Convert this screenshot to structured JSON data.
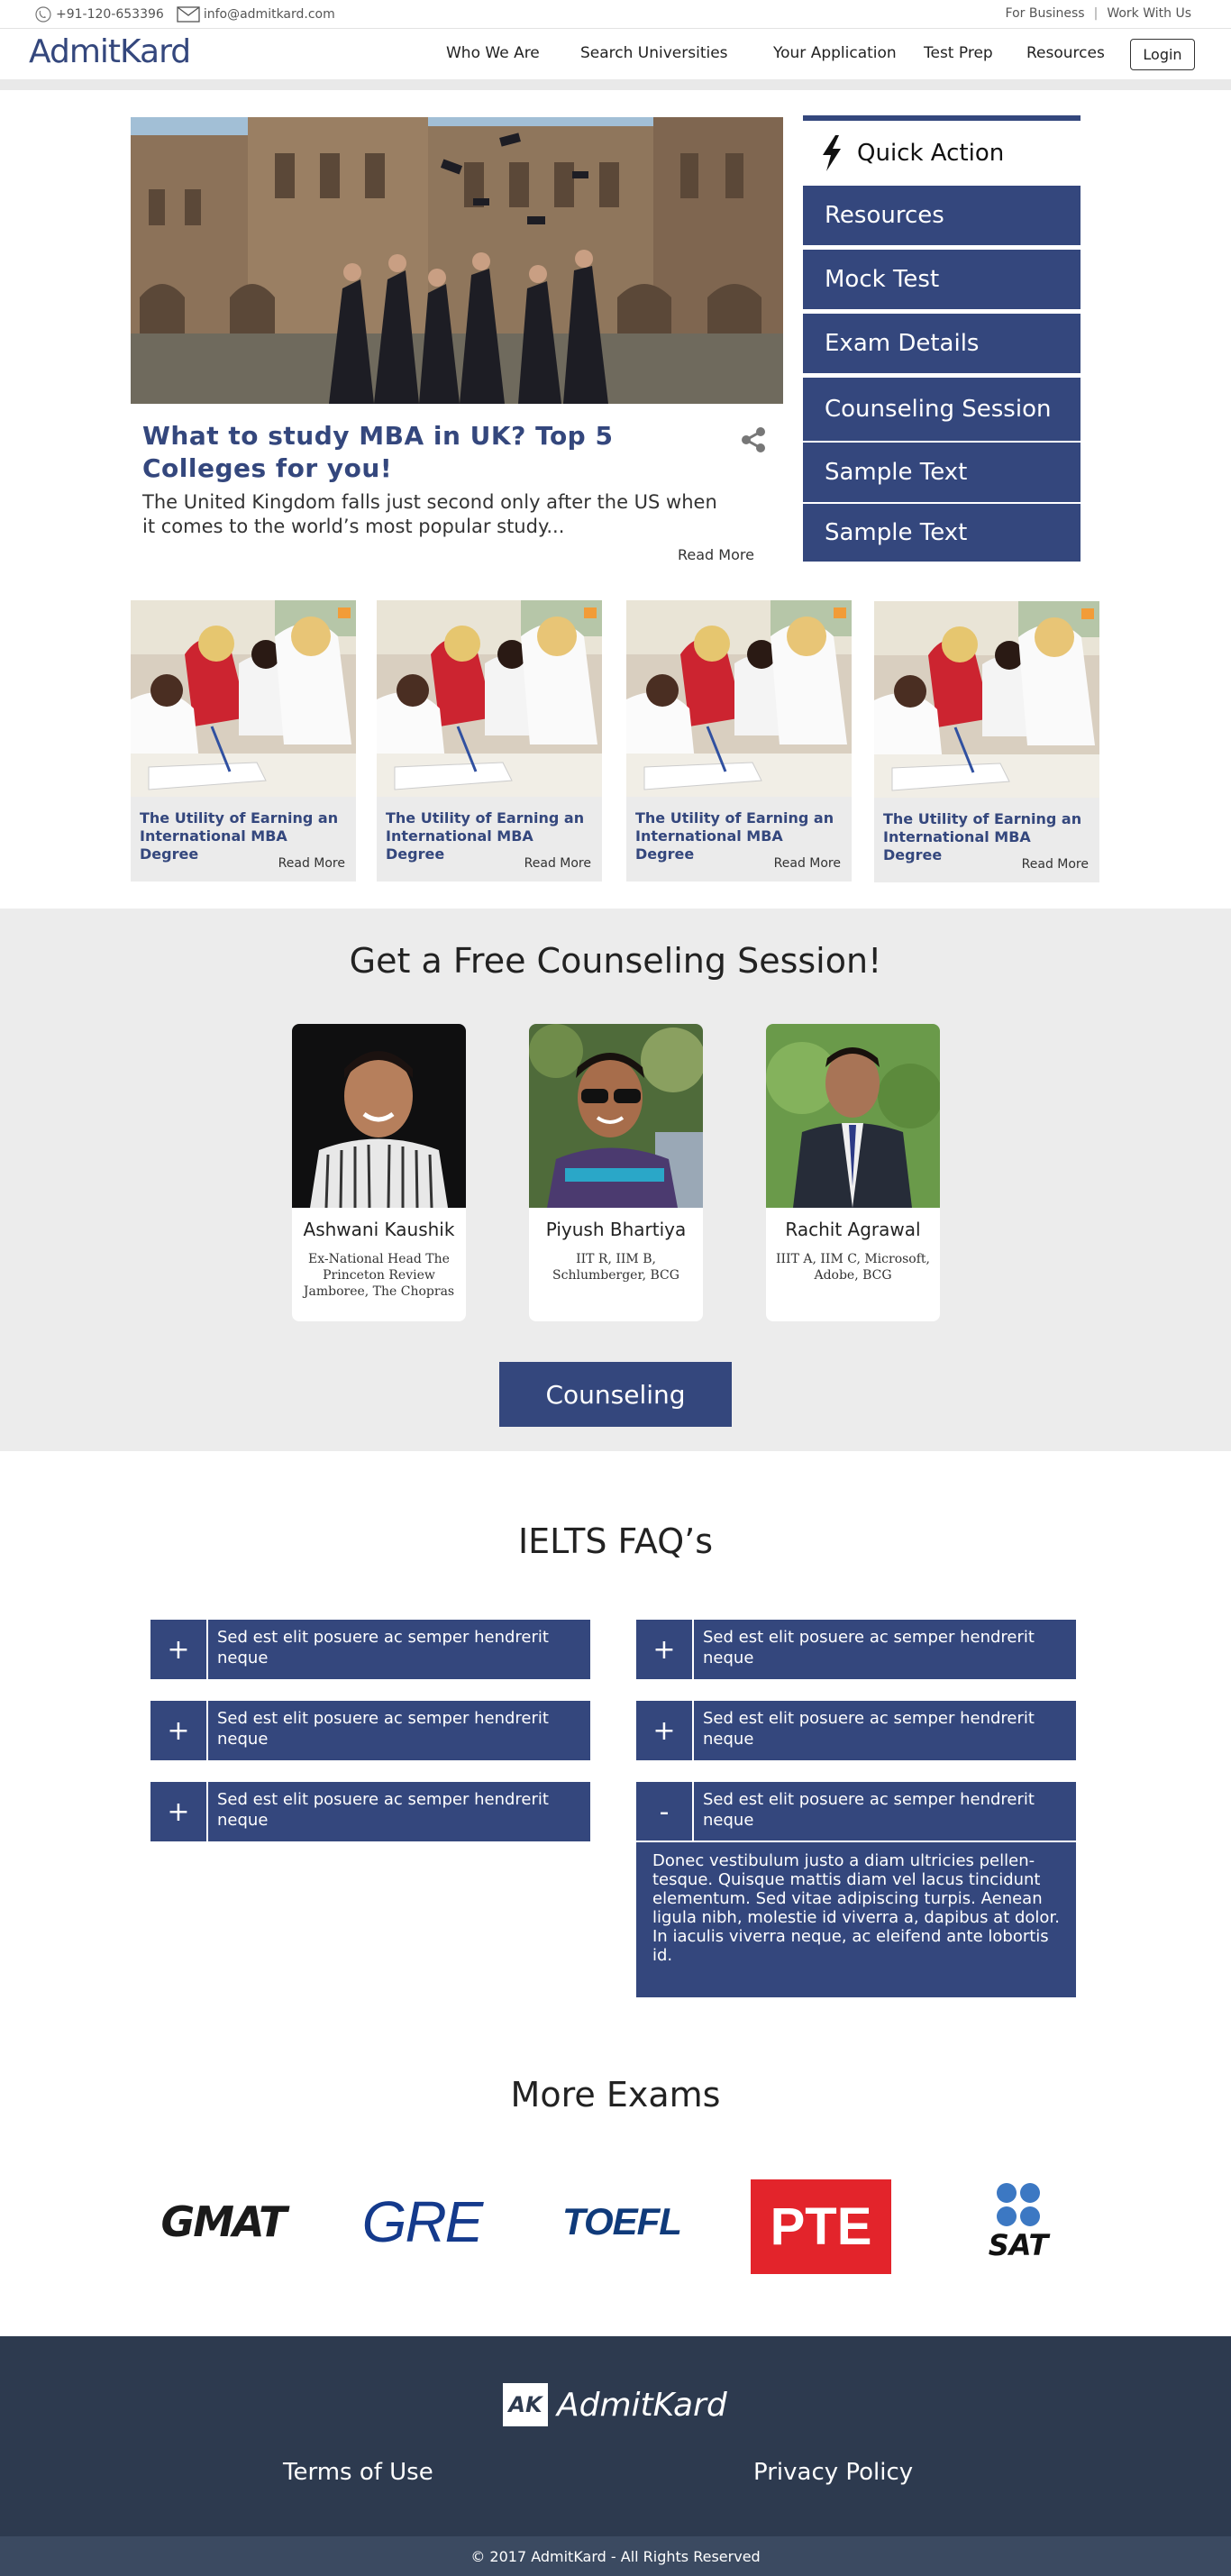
{
  "topbar": {
    "phone": "+91-120-653396",
    "email": "info@admitkard.com",
    "for_business": "For Business",
    "separator": "|",
    "work_with_us": "Work With Us"
  },
  "nav": {
    "logo": "AdmitKard",
    "links": [
      "Who We Are",
      "Search Universities",
      "Your Application",
      "Test Prep",
      "Resources"
    ],
    "login": "Login"
  },
  "hero": {
    "title": "What to study MBA in UK? Top 5 Colleges for you!",
    "description": "The United Kingdom falls just second only after the US when it comes to the world’s  most popular study...",
    "read_more": "Read More"
  },
  "quick_action": {
    "title": "Quick Action",
    "items": [
      "Resources",
      "Mock Test",
      "Exam Details",
      "Counseling Session",
      "Sample Text",
      "Sample Text"
    ]
  },
  "cards": [
    {
      "title": "The Utility of Earning an International MBA Degree",
      "read_more": "Read More"
    },
    {
      "title": "The Utility of Earning an International MBA Degree",
      "read_more": "Read More"
    },
    {
      "title": "The Utility of Earning an International MBA Degree",
      "read_more": "Read More"
    },
    {
      "title": "The Utility of Earning an International MBA Degree",
      "read_more": "Read More"
    }
  ],
  "counseling": {
    "heading": "Get a Free Counseling Session!",
    "people": [
      {
        "name": "Ashwani Kaushik",
        "info": "Ex-National Head The Princeton Review Jamboree, The Chopras"
      },
      {
        "name": "Piyush Bhartiya",
        "info": "IIT R, IIM B, Schlumberger, BCG"
      },
      {
        "name": "Rachit Agrawal",
        "info": "IIIT A, IIM C, Microsoft, Adobe, BCG"
      }
    ],
    "button": "Counseling"
  },
  "faq": {
    "heading": "IELTS FAQ’s",
    "items": [
      {
        "sign": "+",
        "question": "Sed est elit posuere ac semper hendrerit neque"
      },
      {
        "sign": "+",
        "question": "Sed est elit posuere ac semper hendrerit neque"
      },
      {
        "sign": "+",
        "question": "Sed est elit posuere ac semper hendrerit neque"
      },
      {
        "sign": "+",
        "question": "Sed est elit posuere ac semper hendrerit neque"
      },
      {
        "sign": "+",
        "question": "Sed est elit posuere ac semper hendrerit neque"
      },
      {
        "sign": "-",
        "question": "Sed est elit posuere ac semper hendrerit neque"
      }
    ],
    "answer": "Donec vestibulum justo a diam ultricies pellen-tesque. Quisque mattis diam vel lacus tincidunt elementum. Sed vitae adipiscing turpis. Aenean ligula nibh, molestie id viverra a, dapibus at dolor. In iaculis viverra neque, ac eleifend ante lobortis id."
  },
  "exams": {
    "heading": "More Exams",
    "logos": [
      "GMAT",
      "GRE",
      "TOEFL",
      "PTE",
      "SAT"
    ]
  },
  "footer": {
    "logo_mark": "AK",
    "logo_text": "AdmitKard",
    "terms": "Terms of Use",
    "privacy": "Privacy Policy",
    "copyright": "© 2017 AdmitKard - All Rights Reserved"
  },
  "colors": {
    "brand": "#34477d",
    "footer": "#2d3a4f",
    "section_bg": "#ececec",
    "pte_red": "#e3242b",
    "sat_blue": "#3c78c3"
  },
  "icons": [
    "phone-icon",
    "mail-icon",
    "share-icon",
    "lightning-icon"
  ]
}
